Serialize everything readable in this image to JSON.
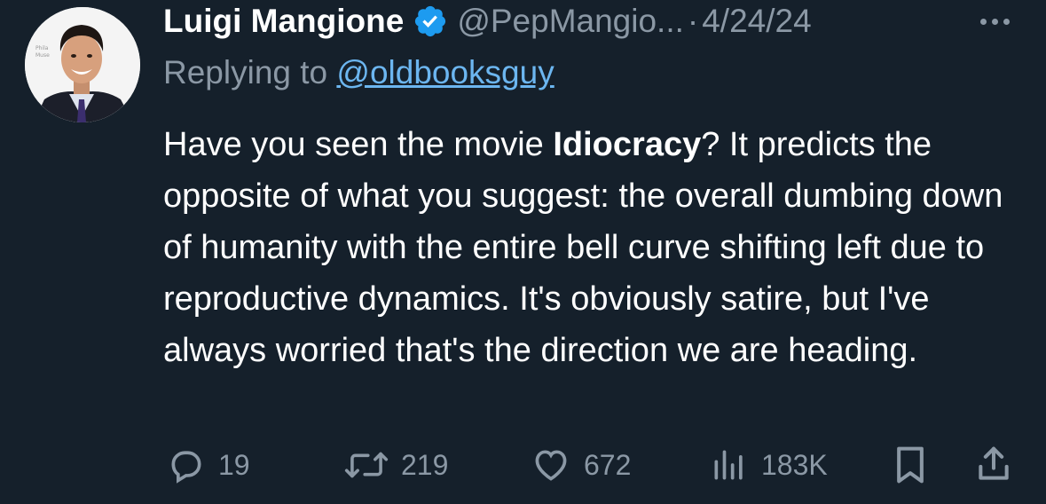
{
  "author": {
    "display_name": "Luigi Mangione",
    "handle": "@PepMangio...",
    "separator": "·",
    "date": "4/24/24",
    "verified": true
  },
  "reply_context": {
    "prefix": "Replying to ",
    "mention": "@oldbooksguy"
  },
  "tweet": {
    "text_before": "Have you seen the movie ",
    "text_bold": "Idiocracy",
    "text_after": "? It predicts the opposite of what you suggest: the overall dumbing down of humanity with the entire bell curve shifting left due to reproductive dynamics. It's obviously satire, but I've always worried that's the direction we are heading."
  },
  "stats": {
    "replies": "19",
    "retweets": "219",
    "likes": "672",
    "views": "183K"
  },
  "icons": {
    "verified": "verified-badge-icon",
    "more": "more-options-icon",
    "reply": "reply-icon",
    "retweet": "retweet-icon",
    "like": "heart-icon",
    "views": "views-bar-chart-icon",
    "bookmark": "bookmark-icon",
    "share": "share-icon"
  },
  "colors": {
    "background": "#15202b",
    "text_primary": "#ffffff",
    "text_secondary": "#8b98a5",
    "link": "#6cb6f0",
    "verified": "#1d9bf0"
  }
}
